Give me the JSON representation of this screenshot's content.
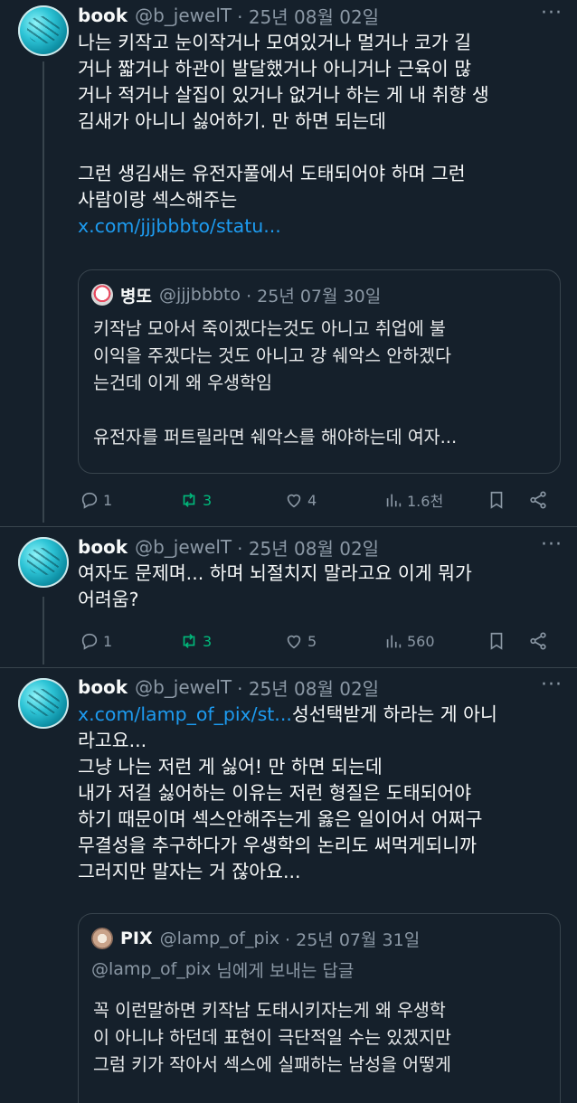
{
  "tweets": [
    {
      "name": "book",
      "handle": "@b_jewelT",
      "date": "· 25년 08월 02일",
      "lines": [
        "나는 키작고 눈이작거나 모여있거나 멀거나 코가 길",
        "거나 짧거나 하관이 발달했거나 아니거나 근육이 많",
        "거나 적거나 살집이 있거나 없거나 하는 게 내 취향 생",
        "김새가 아니니 싫어하기. 만 하면 되는데",
        "",
        "그런 생김새는 유전자풀에서 도태되어야 하며  그런",
        "사람이랑 섹스해주는"
      ],
      "link": "x.com/jjjbbbto/statu...",
      "quote": {
        "name": "병또",
        "handle": "@jjjbbbto",
        "date": "· 25년 07월 30일",
        "lines": [
          "키작남 모아서 죽이겠다는것도 아니고 취업에 불",
          "이익을 주겠다는 것도 아니고 걍 쉐악스 안하겠다",
          "는건데 이게 왜 우생학임",
          "",
          "유전자를 퍼트릴라면 쉐악스를 해야하는데 여자..."
        ]
      },
      "stats": {
        "replies": "1",
        "retweets": "3",
        "likes": "4",
        "views": "1.6천"
      }
    },
    {
      "name": "book",
      "handle": "@b_jewelT",
      "date": "· 25년 08월 02일",
      "lines": [
        "여자도 문제며... 하며 뇌절치지 말라고요 이게 뭐가",
        "어려움?"
      ],
      "stats": {
        "replies": "1",
        "retweets": "3",
        "likes": "5",
        "views": "560"
      }
    },
    {
      "name": "book",
      "handle": "@b_jewelT",
      "date": "· 25년 08월 02일",
      "link": "x.com/lamp_of_pix/st...",
      "link_tail": "성선택받게 하라는 게 아니",
      "lines": [
        "라고요...",
        "그냥 나는 저런 게 싫어! 만 하면 되는데",
        "내가 저걸 싫어하는 이유는 저런 형질은 도태되어야",
        "하기 때문이며 섹스안해주는게 옳은 일이어서 어쩌구",
        "무결성을 추구하다가 우생학의 논리도 써먹게되니까",
        "그러지만 말자는 거 잖아요..."
      ],
      "quote": {
        "name": "PIX",
        "handle": "@lamp_of_pix",
        "date": "· 25년 07월 31일",
        "reply_prefix": "@lamp_of_pix",
        "reply_suffix": " 님에게 보내는 답글",
        "lines": [
          "꼭 이런말하면 키작남 도태시키자는게 왜 우생학",
          "이 아니냐 하던데 표현이 극단적일 수는 있겠지만",
          "그럼 키가 작아서 섹스에 실패하는 남성을 어떻게"
        ]
      }
    }
  ],
  "more_label": "···",
  "colors": {
    "background": "#15202b",
    "accent": "#1d9bf0",
    "retweet": "#00ba7c",
    "muted": "#8b98a5"
  }
}
